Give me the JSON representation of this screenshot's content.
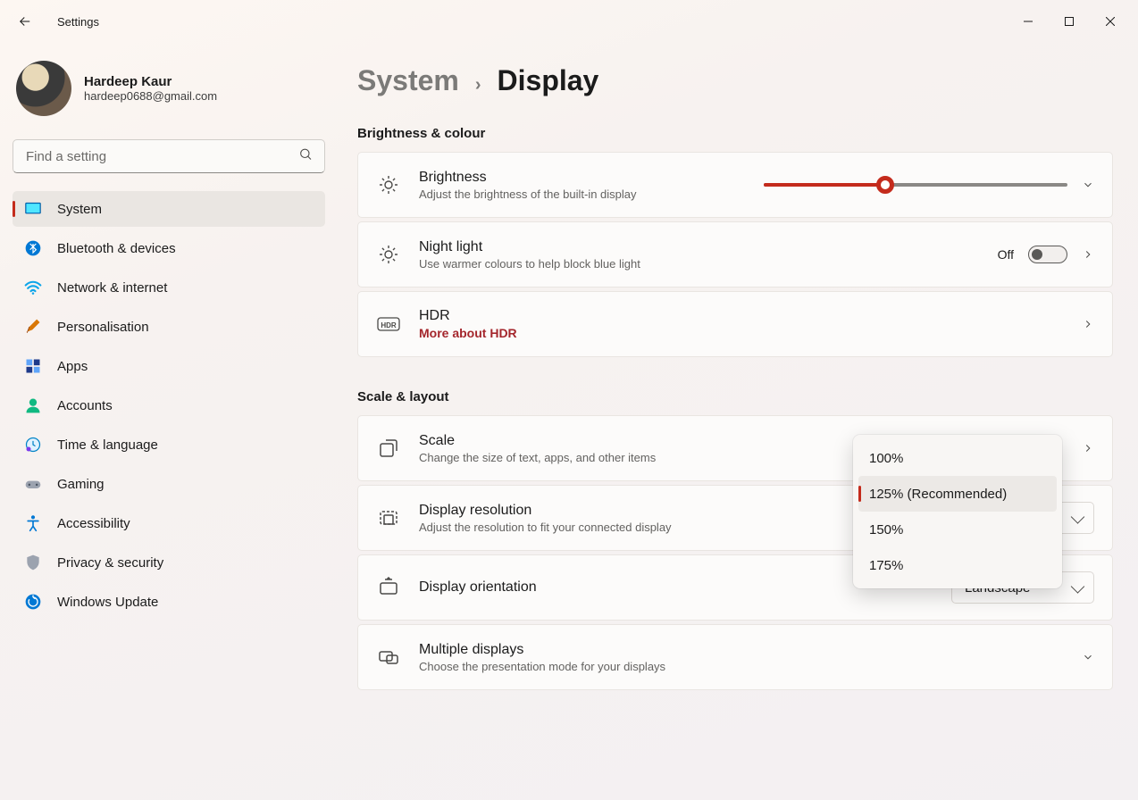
{
  "app_title": "Settings",
  "user": {
    "name": "Hardeep Kaur",
    "email": "hardeep0688@gmail.com"
  },
  "search": {
    "placeholder": "Find a setting"
  },
  "nav": [
    "System",
    "Bluetooth & devices",
    "Network & internet",
    "Personalisation",
    "Apps",
    "Accounts",
    "Time & language",
    "Gaming",
    "Accessibility",
    "Privacy & security",
    "Windows Update"
  ],
  "breadcrumb": {
    "parent": "System",
    "current": "Display"
  },
  "sections": {
    "brightness_header": "Brightness & colour",
    "scale_header": "Scale & layout"
  },
  "cards": {
    "brightness": {
      "title": "Brightness",
      "sub": "Adjust the brightness of the built-in display"
    },
    "nightlight": {
      "title": "Night light",
      "sub": "Use warmer colours to help block blue light",
      "state": "Off"
    },
    "hdr": {
      "title": "HDR",
      "link": "More about HDR"
    },
    "scale": {
      "title": "Scale",
      "sub": "Change the size of text, apps, and other items"
    },
    "resolution": {
      "title": "Display resolution",
      "sub": "Adjust the resolution to fit your connected display"
    },
    "orientation": {
      "title": "Display orientation",
      "value": "Landscape"
    },
    "multiple": {
      "title": "Multiple displays",
      "sub": "Choose the presentation mode for your displays"
    }
  },
  "scale_options": [
    "100%",
    "125% (Recommended)",
    "150%",
    "175%"
  ],
  "scale_selected_index": 1
}
